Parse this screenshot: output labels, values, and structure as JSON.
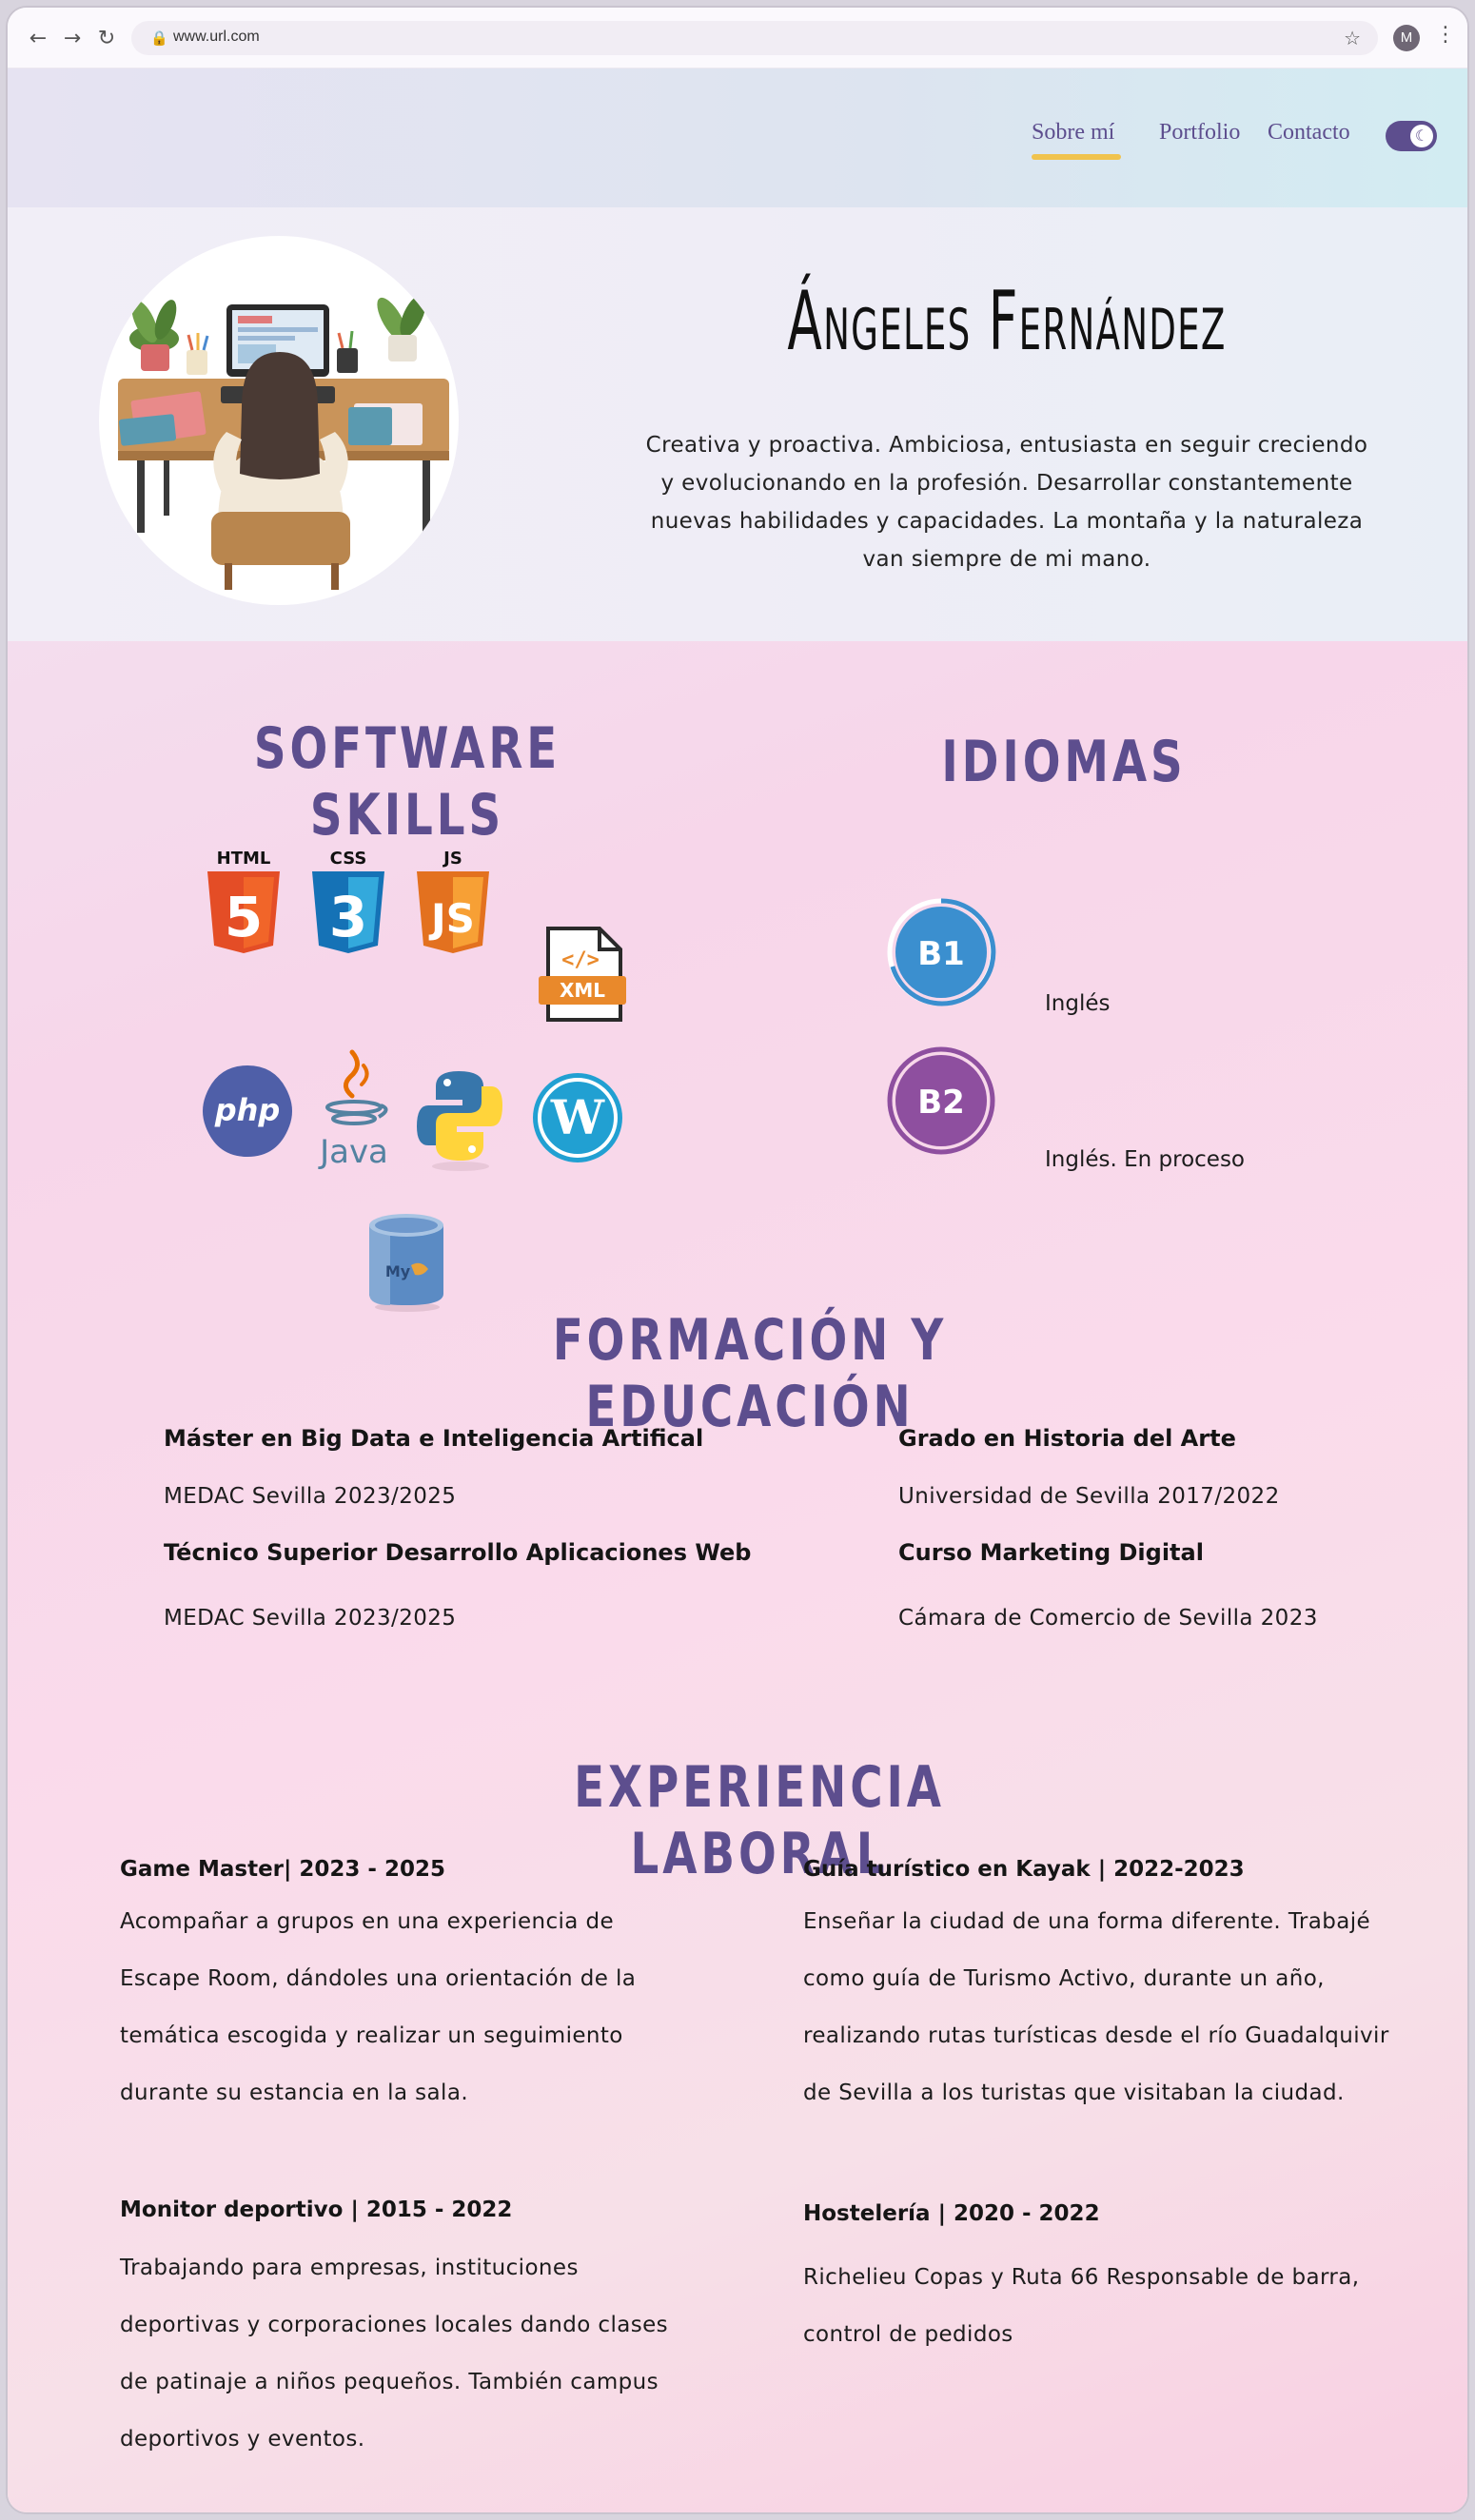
{
  "browser": {
    "url": "www.url.com",
    "profile_initial": "M"
  },
  "nav": {
    "items": [
      "Sobre mí",
      "Portfolio",
      "Contacto"
    ],
    "active": "Sobre mí"
  },
  "hero": {
    "name": "Ángeles Fernández",
    "bio": "Creativa y proactiva. Ambiciosa, entusiasta en seguir creciendo y evolucionando en la profesión. Desarrollar constantemente nuevas habilidades y capacidades. La montaña y la naturaleza van siempre de mi mano."
  },
  "skills": {
    "title": "SOFTWARE SKILLS",
    "icons": [
      {
        "label": "HTML",
        "glyph": "5",
        "icon": "html5-icon",
        "color": "#e44d26"
      },
      {
        "label": "CSS",
        "glyph": "3",
        "icon": "css3-icon",
        "color": "#1572b6"
      },
      {
        "label": "JS",
        "glyph": "JS",
        "icon": "javascript-icon",
        "color": "#f08a24"
      },
      {
        "label": "XML",
        "glyph": "</>",
        "icon": "xml-file-icon",
        "color": "#e9892b"
      },
      {
        "label": "php",
        "icon": "php-icon",
        "color": "#4f5fa8"
      },
      {
        "label": "Java",
        "icon": "java-icon",
        "color": "#5382a1"
      },
      {
        "label": "",
        "icon": "python-icon",
        "color": "#3776ab"
      },
      {
        "label": "",
        "icon": "wordpress-icon",
        "color": "#21759b"
      },
      {
        "label": "My",
        "icon": "mysql-icon",
        "color": "#4a79b6"
      }
    ]
  },
  "languages": {
    "title": "IDIOMAS",
    "items": [
      {
        "level": "B1",
        "name": "Inglés",
        "color": "#3b8fcf"
      },
      {
        "level": "B2",
        "name": "Inglés. En proceso",
        "color": "#8e4f9f"
      }
    ]
  },
  "education": {
    "title": "FORMACIÓN Y EDUCACIÓN",
    "items": [
      {
        "title": "Máster en Big Data e Inteligencia Artifical",
        "place": "MEDAC Sevilla 2023/2025"
      },
      {
        "title": "Técnico Superior Desarrollo Aplicaciones Web",
        "place": "MEDAC Sevilla 2023/2025"
      },
      {
        "title": "Grado en Historia del Arte",
        "place": "Universidad de Sevilla 2017/2022"
      },
      {
        "title": "Curso Marketing Digital",
        "place": "Cámara de Comercio de Sevilla 2023"
      }
    ]
  },
  "experience": {
    "title": "EXPERIENCIA LABORAL",
    "jobs": [
      {
        "title": "Game Master| 2023 - 2025",
        "lines": [
          "Acompañar a grupos en una experiencia de",
          "Escape Room, dándoles una orientación de la",
          "temática escogida y realizar un seguimiento",
          "durante su estancia en la sala."
        ]
      },
      {
        "title": "Guía turístico en Kayak | 2022-2023",
        "lines": [
          "Enseñar la ciudad de una forma diferente. Trabajé",
          "como guía de Turismo Activo, durante un año,",
          "realizando rutas turísticas desde el río Guadalquivir",
          "de Sevilla a los turistas que visitaban la ciudad."
        ]
      },
      {
        "title": "Monitor deportivo | 2015 - 2022",
        "lines": [
          "Trabajando para empresas, instituciones",
          "deportivas y  corporaciones locales dando clases",
          "de patinaje a niños pequeños. También campus",
          "deportivos y eventos."
        ]
      },
      {
        "title": "Hostelería | 2020 - 2022",
        "lines": [
          "Richelieu Copas y Ruta 66 Responsable de barra,",
          "control de pedidos"
        ]
      }
    ]
  }
}
